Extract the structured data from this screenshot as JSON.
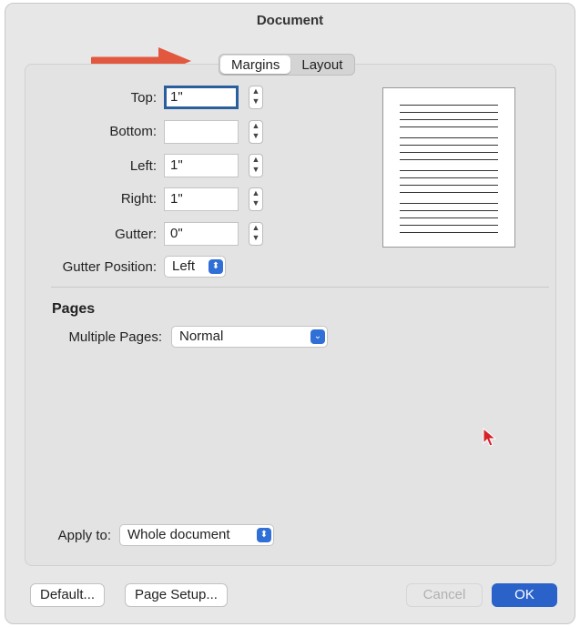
{
  "window": {
    "title": "Document"
  },
  "tabs": [
    {
      "label": "Margins",
      "active": true
    },
    {
      "label": "Layout",
      "active": false
    }
  ],
  "margins": {
    "top": {
      "label": "Top:",
      "value": "1\""
    },
    "bottom": {
      "label": "Bottom:",
      "value": ""
    },
    "left": {
      "label": "Left:",
      "value": "1\""
    },
    "right": {
      "label": "Right:",
      "value": "1\""
    },
    "gutter": {
      "label": "Gutter:",
      "value": "0\""
    },
    "gutter_position": {
      "label": "Gutter Position:",
      "value": "Left"
    }
  },
  "pages": {
    "section_title": "Pages",
    "multiple_pages": {
      "label": "Multiple Pages:",
      "value": "Normal"
    }
  },
  "apply_to": {
    "label": "Apply to:",
    "value": "Whole document"
  },
  "buttons": {
    "default": "Default...",
    "page_setup": "Page Setup...",
    "cancel": "Cancel",
    "ok": "OK"
  },
  "colors": {
    "accent": "#2b62c9",
    "arrow": "#e2583e"
  }
}
